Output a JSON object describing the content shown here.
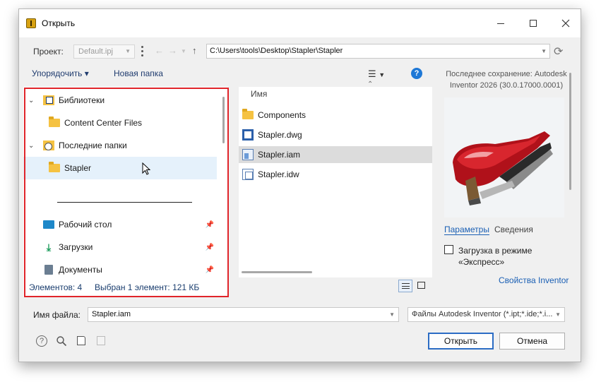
{
  "window": {
    "title": "Открыть",
    "minimize_label": "Свернуть",
    "maximize_label": "Развернуть",
    "close_label": "Закрыть"
  },
  "project": {
    "label": "Проект:",
    "value": "Default.ipj"
  },
  "path": {
    "value": "C:\\Users\\tools\\Desktop\\Stapler\\Stapler"
  },
  "toolbar": {
    "organize_label": "Упорядочить ▾",
    "new_folder_label": "Новая папка"
  },
  "nav": {
    "items": [
      {
        "label": "Библиотеки",
        "icon": "libraries-icon",
        "expandable": true
      },
      {
        "label": "Content Center Files",
        "icon": "folder-icon",
        "expandable": false
      },
      {
        "label": "Последние папки",
        "icon": "recent-folders-icon",
        "expandable": true
      },
      {
        "label": "Stapler",
        "icon": "folder-icon",
        "expandable": false,
        "selected": true
      },
      {
        "label": "Рабочий стол",
        "icon": "desktop-icon",
        "pinned": true
      },
      {
        "label": "Загрузки",
        "icon": "downloads-icon",
        "pinned": true
      },
      {
        "label": "Документы",
        "icon": "documents-icon",
        "pinned": true
      }
    ]
  },
  "file_list": {
    "column_header": "Имя",
    "items": [
      {
        "name": "Components",
        "icon": "folder-icon"
      },
      {
        "name": "Stapler.dwg",
        "icon": "dwg-file-icon"
      },
      {
        "name": "Stapler.iam",
        "icon": "assembly-file-icon",
        "selected": true
      },
      {
        "name": "Stapler.idw",
        "icon": "drawing-file-icon"
      }
    ]
  },
  "status": {
    "items_count": "Элементов: 4",
    "selection": "Выбран 1 элемент: 121 КБ"
  },
  "preview": {
    "last_saved": "Последнее сохранение: Autodesk Inventor 2026 (30.0.17000.0001)",
    "tab_params": "Параметры",
    "tab_details": "Сведения",
    "express_label": "Загрузка в режиме «Экспресс»",
    "express_checked": false,
    "inventor_props": "Свойства Inventor"
  },
  "filename": {
    "label": "Имя файла:",
    "value": "Stapler.iam"
  },
  "filetype": {
    "value": "Файлы Autodesk Inventor (*.ipt;*.ide;*.i..."
  },
  "buttons": {
    "open": "Открыть",
    "cancel": "Отмена"
  },
  "colors": {
    "accent": "#1e78d6",
    "highlight_frame": "#e0242a",
    "selected_nav": "#e5f1fb",
    "selected_file": "#dcdcdc"
  }
}
